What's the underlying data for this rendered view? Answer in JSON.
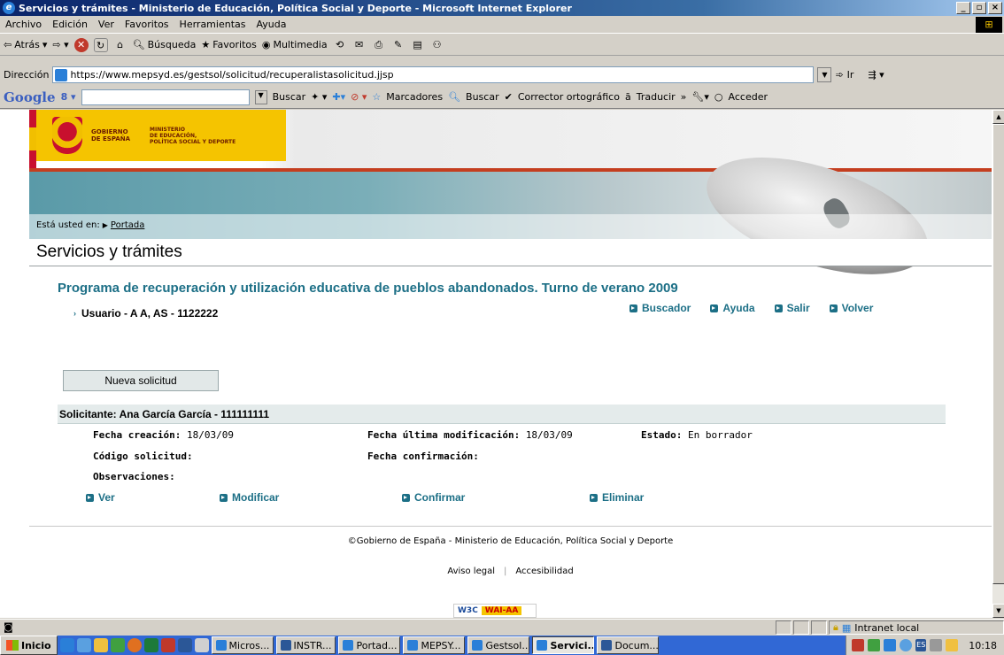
{
  "window": {
    "title": "Servicios y trámites - Ministerio de Educación, Política Social y Deporte - Microsoft Internet Explorer",
    "min": "_",
    "max": "▫",
    "close": "×"
  },
  "menu": [
    "Archivo",
    "Edición",
    "Ver",
    "Favoritos",
    "Herramientas",
    "Ayuda"
  ],
  "toolbar": {
    "back": "Atrás",
    "search": "Búsqueda",
    "favorites": "Favoritos",
    "multimedia": "Multimedia"
  },
  "address": {
    "label": "Dirección",
    "url": "https://www.mepsyd.es/gestsol/solicitud/recuperalistasolicitud.jjsp",
    "go": "Ir"
  },
  "google_toolbar": {
    "logo": "Google",
    "buscar": "Buscar",
    "marcadores": "Marcadores",
    "buscar2": "Buscar",
    "corrector": "Corrector ortográfico",
    "traducir": "Traducir",
    "more": "»",
    "acceder": "Acceder"
  },
  "site": {
    "gobierno": [
      "GOBIERNO",
      "DE ESPAÑA"
    ],
    "ministerio": [
      "MINISTERIO",
      "DE EDUCACIÓN,",
      "POLÍTICA SOCIAL Y DEPORTE"
    ],
    "breadcrumb_prefix": "Está usted en:",
    "breadcrumb_link": "Portada",
    "page_title": "Servicios y trámites",
    "program_title": "Programa de recuperación y utilización educativa de pueblos abandonados. Turno de verano 2009",
    "user": "Usuario - A A, AS - 1122222",
    "nav": [
      "Buscador",
      "Ayuda",
      "Salir",
      "Volver"
    ],
    "new_request": "Nueva solicitud",
    "applicant": "Solicitante: Ana García García - 111111111",
    "fields": {
      "fecha_creacion_label": "Fecha creación:",
      "fecha_creacion": "18/03/09",
      "fecha_mod_label": "Fecha última modificación:",
      "fecha_mod": "18/03/09",
      "estado_label": "Estado:",
      "estado": "En borrador",
      "codigo_label": "Código solicitud:",
      "fecha_conf_label": "Fecha confirmación:",
      "observaciones_label": "Observaciones:"
    },
    "actions": [
      "Ver",
      "Modificar",
      "Confirmar",
      "Eliminar"
    ],
    "copyright": "©Gobierno de España - Ministerio de Educación, Política Social y Deporte",
    "legal": [
      "Aviso legal",
      "Accesibilidad"
    ],
    "w3c": "W3C",
    "waiaa": "WAI-AA"
  },
  "status": {
    "zone": "Intranet local"
  },
  "taskbar": {
    "start": "Inicio",
    "tasks": [
      "Micros...",
      "INSTR...",
      "Portad...",
      "MEPSY...",
      "Gestsol...",
      "Servici...",
      "Docum..."
    ],
    "lang": "ES",
    "clock": "10:18"
  },
  "colors": {
    "accent_teal": "#1c6f86",
    "gov_yellow": "#f5c400",
    "title_blue": "#0a246a"
  }
}
